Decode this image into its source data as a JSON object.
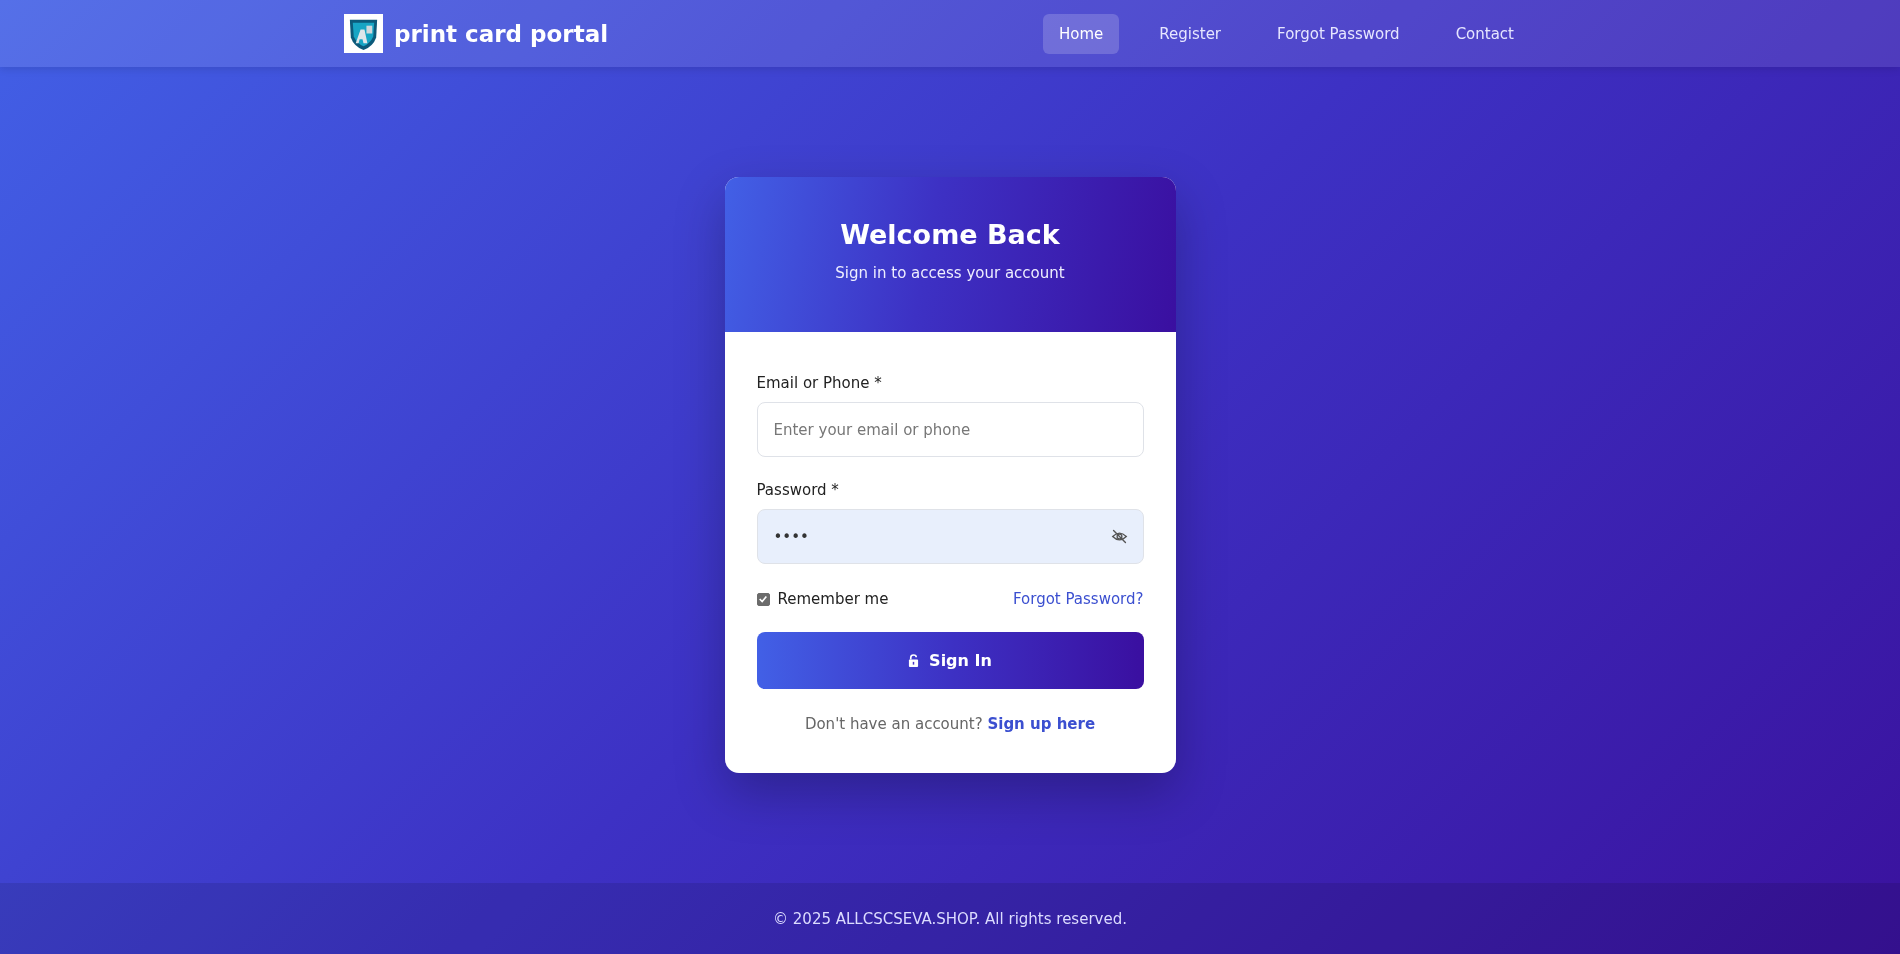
{
  "brand": {
    "name": "print card portal"
  },
  "nav": [
    {
      "label": "Home",
      "selected": true
    },
    {
      "label": "Register",
      "selected": false
    },
    {
      "label": "Forgot Password",
      "selected": false
    },
    {
      "label": "Contact",
      "selected": false
    }
  ],
  "card": {
    "title": "Welcome Back",
    "subtitle": "Sign in to access your account",
    "email": {
      "label": "Email or Phone *",
      "placeholder": "Enter your email or phone"
    },
    "password": {
      "label": "Password *",
      "value": "••••"
    },
    "remember": {
      "label": "Remember me",
      "checked": true
    },
    "forgot_link": "Forgot Password?",
    "submit": "Sign In",
    "signup_prompt": "Don't have an account?",
    "signup_link": "Sign up here"
  },
  "footer": "© 2025 ALLCSCSEVA.SHOP. All rights reserved."
}
